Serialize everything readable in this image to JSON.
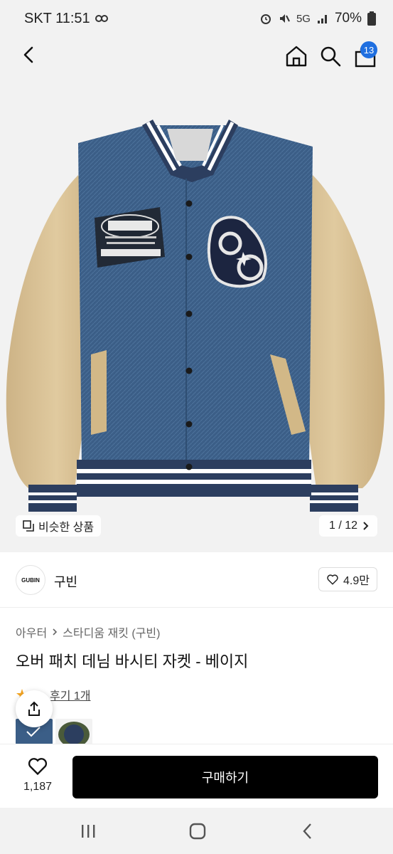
{
  "status_bar": {
    "carrier_time": "SKT 11:51",
    "network": "5G",
    "battery": "70%",
    "icons": [
      "link-icon",
      "alarm-icon",
      "mute-icon",
      "wifi-icon",
      "signal-icon",
      "battery-icon"
    ]
  },
  "header": {
    "icons": [
      "back-icon",
      "home-icon",
      "search-icon",
      "cart-icon"
    ],
    "cart_count": "13"
  },
  "hero": {
    "similar_label": "비슷한 상품",
    "pager": "1 / 12",
    "colors": {
      "denim": "#3b5e87",
      "sleeve": "#d7bf95",
      "rib": "#2c3e5f"
    }
  },
  "brand": {
    "logo_text": "GUBIN",
    "name": "구빈",
    "rating": "4.9만"
  },
  "breadcrumb": {
    "items": [
      "아우터",
      "스타디움 재킷 (구빈)"
    ]
  },
  "product": {
    "title": "오버 패치 데님 바시티 자켓 - 베이지",
    "review_text": "후기 1개"
  },
  "buy_bar": {
    "like_count": "1,187",
    "buy_label": "구매하기"
  },
  "nav": {
    "icons": [
      "recents-icon",
      "home-nav-icon",
      "back-nav-icon"
    ]
  }
}
